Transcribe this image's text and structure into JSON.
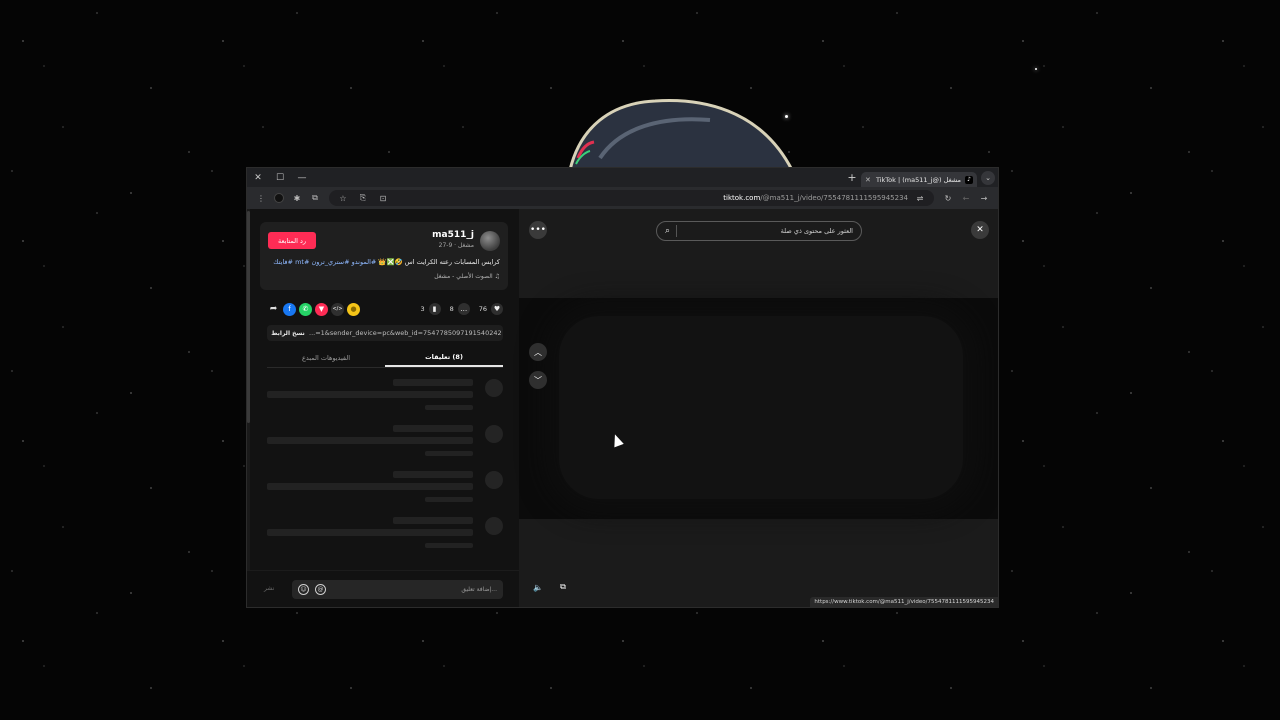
{
  "browser": {
    "tab_title": "TikTok | (ma511_j@) مشغل",
    "url_host": "tiktok.com",
    "url_path": "/@ma511_j/video/7554781111595945234",
    "status_url": "https://www.tiktok.com/@ma511_j/video/7554781111595945234"
  },
  "post": {
    "username": "ma511_j",
    "meta": "مشغل · 9-27",
    "follow_label": "رد المتابعة",
    "caption_text": "كرايس المسابات رعته الكرايت اس 🤣❎👑",
    "caption_hashtags": "#الموندو #ستري_ترون #mt #فايتك",
    "sound": "♫ الصوت الأصلي - مشغل",
    "likes": "76",
    "comments": "8",
    "saves": "3",
    "copy_link_label": "نسخ الرابط",
    "link_text": "...=1&sender_device=pc&web_id=7547785097191540242"
  },
  "tabs": {
    "comments": "(8) تعليقات",
    "creator_videos": "الفيديوهات المبدع"
  },
  "comment_box": {
    "placeholder": "إضافة تعليق...",
    "post_label": "نشر"
  },
  "search": {
    "placeholder": "العثور على محتوى ذي صلة"
  },
  "colors": {
    "accent": "#fe2c55",
    "hashtag": "#8fb9ff",
    "facebook": "#1877f2",
    "whatsapp": "#25d366",
    "red_share": "#fe2c55",
    "coin": "#f5c518"
  },
  "icons": {
    "window_controls": [
      "close-icon",
      "maximize-icon",
      "minimize-icon"
    ],
    "share": [
      "share-arrow-icon",
      "facebook-icon",
      "whatsapp-icon",
      "pinterest-icon",
      "embed-icon",
      "coin-icon"
    ]
  }
}
